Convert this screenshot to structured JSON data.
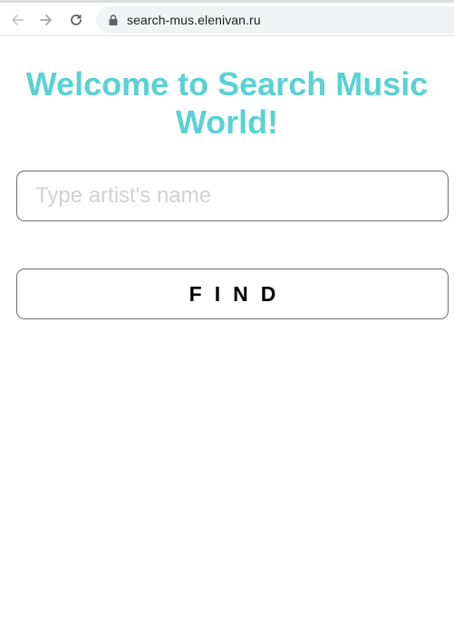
{
  "browser": {
    "url": "search-mus.elenivan.ru",
    "back_icon": "arrow-left-icon",
    "forward_icon": "arrow-right-icon",
    "reload_icon": "reload-icon",
    "lock_icon": "lock-icon"
  },
  "page": {
    "title_line1": "Welcome to Search Music",
    "title_line2": "World!",
    "title_color": "#5ad1d3"
  },
  "search": {
    "placeholder": "Type artist's name",
    "value": ""
  },
  "find_button": {
    "label": "FIND"
  }
}
